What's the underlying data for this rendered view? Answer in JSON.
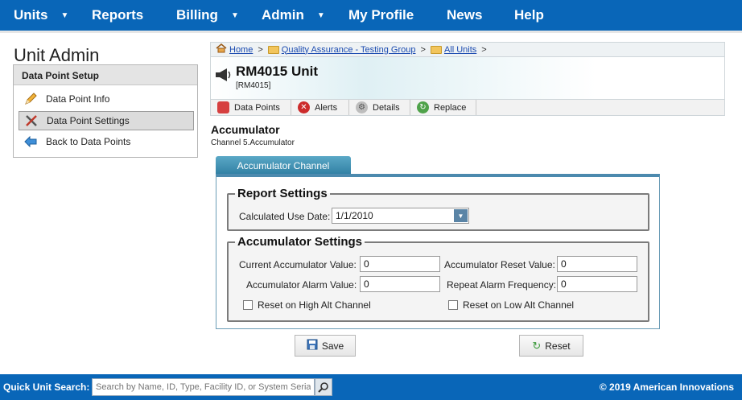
{
  "nav": {
    "units": "Units",
    "reports": "Reports",
    "billing": "Billing",
    "admin": "Admin",
    "profile": "My Profile",
    "news": "News",
    "help": "Help"
  },
  "page_title": "Unit Admin",
  "left_panel": {
    "header": "Data Point Setup",
    "items": [
      {
        "label": "Data Point Info",
        "icon": "pencil-icon"
      },
      {
        "label": "Data Point Settings",
        "icon": "tools-icon",
        "active": true
      },
      {
        "label": "Back to Data Points",
        "icon": "back-arrow-icon"
      }
    ]
  },
  "breadcrumb": {
    "home": "Home",
    "group": "Quality Assurance - Testing Group",
    "all_units": "All Units",
    "separator": ">"
  },
  "unit": {
    "name": "RM4015 Unit",
    "code": "[RM4015]"
  },
  "subtabs": [
    {
      "label": "Data Points",
      "icon": "data-points-icon"
    },
    {
      "label": "Alerts",
      "icon": "alert-icon"
    },
    {
      "label": "Details",
      "icon": "details-gear-icon"
    },
    {
      "label": "Replace",
      "icon": "replace-icon"
    }
  ],
  "section": {
    "title": "Accumulator",
    "subtitle": "Channel 5.Accumulator"
  },
  "tab": {
    "label": "Accumulator Channel"
  },
  "report_settings": {
    "legend": "Report Settings",
    "calc_use_date_label": "Calculated Use Date:",
    "calc_use_date_value": "1/1/2010"
  },
  "accumulator_settings": {
    "legend": "Accumulator Settings",
    "current_value_label": "Current Accumulator Value:",
    "current_value": "0",
    "reset_value_label": "Accumulator Reset Value:",
    "reset_value": "0",
    "alarm_value_label": "Accumulator Alarm Value:",
    "alarm_value": "0",
    "repeat_freq_label": "Repeat Alarm Frequency:",
    "repeat_freq": "0",
    "reset_high_label": "Reset on High Alt Channel",
    "reset_high_checked": false,
    "reset_low_label": "Reset on Low Alt Channel",
    "reset_low_checked": false
  },
  "buttons": {
    "save": "Save",
    "reset": "Reset"
  },
  "footer": {
    "quick_search_label": "Quick Unit Search:",
    "quick_search_placeholder": "Search by Name, ID, Type, Facility ID, or System Serial",
    "copyright": "© 2019 American Innovations"
  },
  "colors": {
    "nav_bg": "#0966b8",
    "tab_accent": "#2f7ea2"
  }
}
